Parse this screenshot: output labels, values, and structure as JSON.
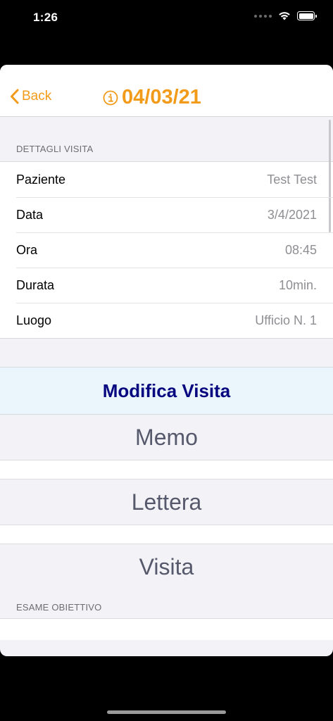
{
  "status": {
    "time": "1:26"
  },
  "nav": {
    "back_label": "Back",
    "title": "04/03/21"
  },
  "details": {
    "header": "DETTAGLI VISITA",
    "rows": [
      {
        "label": "Paziente",
        "value": "Test Test"
      },
      {
        "label": "Data",
        "value": "3/4/2021"
      },
      {
        "label": "Ora",
        "value": "08:45"
      },
      {
        "label": "Durata",
        "value": "10min."
      },
      {
        "label": "Luogo",
        "value": "Ufficio N. 1"
      }
    ]
  },
  "actions": {
    "edit_label": "Modifica Visita",
    "memo_label": "Memo",
    "letter_label": "Lettera",
    "visit_label": "Visita"
  },
  "exam": {
    "header": "ESAME OBIETTIVO"
  },
  "colors": {
    "accent": "#f29b1a",
    "primary_text": "#07077f",
    "primary_bg": "#eaf5fc"
  }
}
